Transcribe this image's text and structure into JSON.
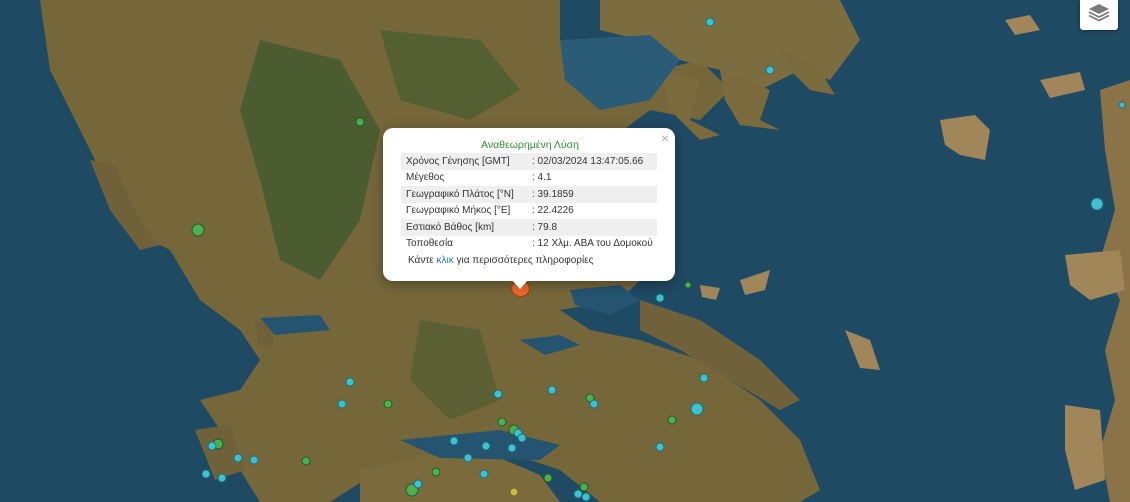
{
  "map": {
    "layers_icon": "layers-stack-icon",
    "colors": {
      "sea": "#1f4a63",
      "land": "#7a6a3c",
      "forest": "#3f5a2c",
      "marker_recent": "#3fc1d0",
      "marker_older": "#4caf50",
      "marker_selected": "#e9692c"
    }
  },
  "popup": {
    "title": "Αναθεωρημένη Λύση",
    "close_symbol": "×",
    "rows": [
      {
        "label": "Χρόνος Γένησης [GMT]",
        "value": ": 02/03/2024 13:47:05.66"
      },
      {
        "label": "Μέγεθος",
        "value": ": 4.1"
      },
      {
        "label": "Γεωγραφικό Πλάτος [°N]",
        "value": ": 39.1859"
      },
      {
        "label": "Γεωγραφικό Μήκος [°E]",
        "value": ": 22.4226"
      },
      {
        "label": "Εστιακό Βάθος [km]",
        "value": ": 79.8"
      },
      {
        "label": "Τοποθεσία",
        "value": ": 12 Χλμ. ΑΒΑ του Δομοκού"
      }
    ],
    "more_prefix": "Κάντε ",
    "more_link": "κλικ",
    "more_suffix": " για περισσότερες πληροφορίες"
  }
}
